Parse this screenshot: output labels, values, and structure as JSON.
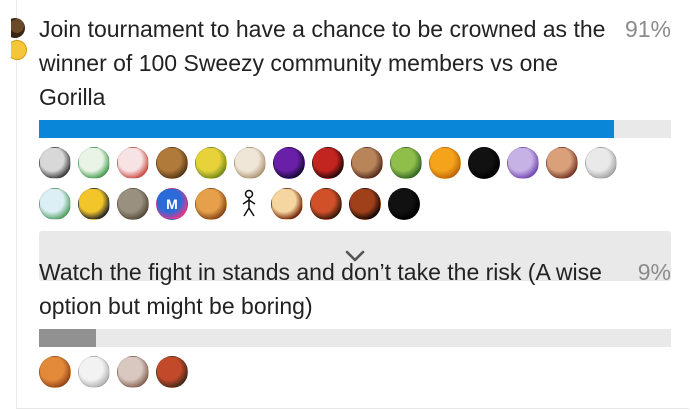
{
  "options": [
    {
      "text": "Join tournament to have a chance to be crowned as the winner of 100 Sweezy community members vs one Gorilla",
      "percent": "91%",
      "fraction": 0.91,
      "bar_color": "#0a86d9",
      "voters": [
        {
          "icon": "gray-creature-avatar",
          "c1": "#d8d8d8",
          "c2": "#444444",
          "label": ""
        },
        {
          "icon": "green-frog-avatar",
          "c1": "#eaf4e6",
          "c2": "#4fa35a",
          "label": ""
        },
        {
          "icon": "red-cartoon-avatar",
          "c1": "#f7e3e3",
          "c2": "#d0554d",
          "label": ""
        },
        {
          "icon": "brown-dog-avatar",
          "c1": "#b07a3a",
          "c2": "#5a3a18",
          "label": ""
        },
        {
          "icon": "yellow-green-avatar",
          "c1": "#e7d23a",
          "c2": "#7a8f1e",
          "label": ""
        },
        {
          "icon": "beige-blob-avatar",
          "c1": "#efe6d8",
          "c2": "#b39b7a",
          "label": ""
        },
        {
          "icon": "purple-space-avatar",
          "c1": "#6a1fa8",
          "c2": "#1b0a3a",
          "label": ""
        },
        {
          "icon": "red-figure-avatar",
          "c1": "#c2241f",
          "c2": "#2a0a0a",
          "label": ""
        },
        {
          "icon": "crowd-photo-avatar",
          "c1": "#b8845a",
          "c2": "#5a3020",
          "label": ""
        },
        {
          "icon": "green-landscape-avatar",
          "c1": "#8fbf4a",
          "c2": "#3a6a2a",
          "label": ""
        },
        {
          "icon": "orange-cat-avatar",
          "c1": "#f5a31a",
          "c2": "#c36a0a",
          "label": ""
        },
        {
          "icon": "stick-figure-black-avatar",
          "c1": "#111111",
          "c2": "#000000",
          "label": ""
        },
        {
          "icon": "purple-character-avatar",
          "c1": "#c7b2e6",
          "c2": "#7a4fb8",
          "label": ""
        },
        {
          "icon": "anime-girl-avatar",
          "c1": "#d9a07a",
          "c2": "#7a3a2a",
          "label": ""
        },
        {
          "icon": "moon-avatar",
          "c1": "#e9e9e9",
          "c2": "#a9a9a9",
          "label": ""
        },
        {
          "icon": "green-pencil-avatar",
          "c1": "#dceff5",
          "c2": "#5aa36a",
          "label": ""
        },
        {
          "icon": "yellow-pikachu-avatar",
          "c1": "#f2c52a",
          "c2": "#2a2a2a",
          "label": ""
        },
        {
          "icon": "gray-raccoon-avatar",
          "c1": "#9a9080",
          "c2": "#5a5040",
          "label": ""
        },
        {
          "icon": "letter-m-avatar",
          "c1": "#2a6ad9",
          "c2": "#e23a8a",
          "label": "M"
        },
        {
          "icon": "burger-avatar",
          "c1": "#e6a04a",
          "c2": "#8a4a1a",
          "label": ""
        },
        {
          "icon": "stick-figure-avatar",
          "c1": "#ffffff",
          "c2": "#ffffff",
          "label": ""
        },
        {
          "icon": "clown-face-avatar",
          "c1": "#f5d5a0",
          "c2": "#7a2a0a",
          "label": ""
        },
        {
          "icon": "red-hair-avatar",
          "c1": "#d0502a",
          "c2": "#3a1a0a",
          "label": ""
        },
        {
          "icon": "dark-fire-avatar",
          "c1": "#a0401a",
          "c2": "#1a0a05",
          "label": ""
        },
        {
          "icon": "chrome-logo-avatar",
          "c1": "#111111",
          "c2": "#000000",
          "label": ""
        }
      ]
    },
    {
      "text": "Watch the fight in stands and don’t take the risk (A wise option but might be boring)",
      "percent": "9%",
      "fraction": 0.09,
      "bar_color": "#919191",
      "voters": [
        {
          "icon": "orange-cat-avatar",
          "c1": "#e38a3a",
          "c2": "#9a4a1a",
          "label": ""
        },
        {
          "icon": "white-bear-avatar",
          "c1": "#f2f2f2",
          "c2": "#b5b5b5",
          "label": ""
        },
        {
          "icon": "brown-puppy-avatar",
          "c1": "#d9c8c0",
          "c2": "#8a6a5a",
          "label": ""
        },
        {
          "icon": "monkey-avatar",
          "c1": "#c24a2a",
          "c2": "#4a2a1a",
          "label": ""
        }
      ]
    }
  ],
  "expand_icon": "chevron-down-icon"
}
